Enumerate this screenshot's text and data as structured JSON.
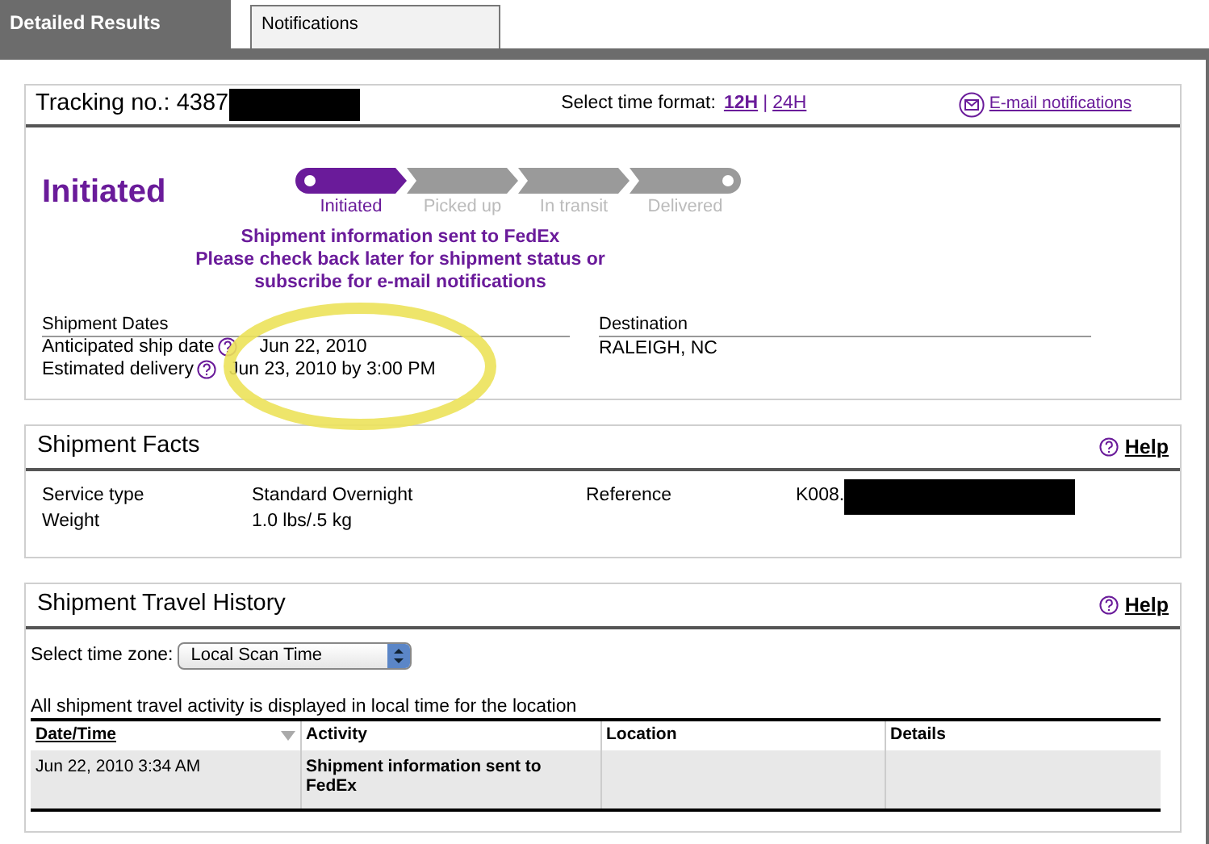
{
  "tabs": [
    {
      "label": "Detailed Results",
      "selected": true
    },
    {
      "label": "Notifications",
      "selected": false
    }
  ],
  "tracking": {
    "label": "Tracking no.:",
    "number": "4387",
    "time_format_label": "Select time format:",
    "formats": [
      {
        "label": "12H",
        "selected": true
      },
      {
        "label": "24H",
        "selected": false
      }
    ],
    "separator": "|",
    "email_link": "E-mail notifications"
  },
  "status": {
    "title": "Initiated",
    "stages": [
      {
        "label": "Initiated",
        "done": true
      },
      {
        "label": "Picked up",
        "done": false
      },
      {
        "label": "In transit",
        "done": false
      },
      {
        "label": "Delivered",
        "done": false
      }
    ],
    "message": [
      "Shipment information sent to FedEx",
      "Please check back later for shipment status or",
      "subscribe for e-mail notifications"
    ]
  },
  "dates": {
    "heading": "Shipment Dates",
    "rows": [
      {
        "label": "Anticipated ship date",
        "value": "Jun 22, 2010"
      },
      {
        "label": "Estimated delivery",
        "value": "Jun 23, 2010 by 3:00 PM"
      }
    ]
  },
  "destination": {
    "heading": "Destination",
    "value": "RALEIGH, NC"
  },
  "facts": {
    "title": "Shipment Facts",
    "help": "Help",
    "rows": [
      {
        "label": "Service type",
        "value": "Standard Overnight"
      },
      {
        "label": "Weight",
        "value": "1.0 lbs/.5 kg"
      }
    ],
    "reference_label": "Reference",
    "reference_value": "K008."
  },
  "history": {
    "title": "Shipment Travel History",
    "help": "Help",
    "timezone_label": "Select time zone:",
    "timezone_value": "Local Scan Time",
    "note": "All shipment travel activity is displayed in local time for the location",
    "columns": [
      "Date/Time",
      "Activity",
      "Location",
      "Details"
    ],
    "rows": [
      [
        "Jun 22, 2010 3:34 AM",
        "Shipment information sent to FedEx",
        "",
        ""
      ]
    ]
  }
}
